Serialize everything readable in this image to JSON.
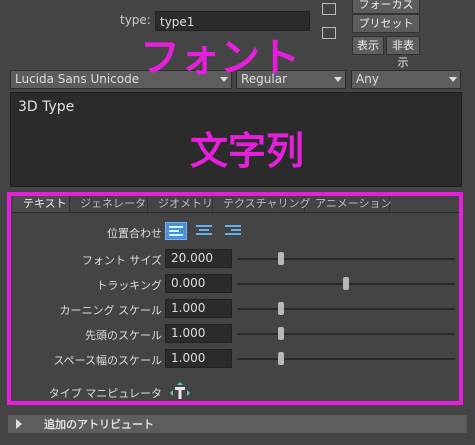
{
  "header": {
    "type_label": "type:",
    "type_value": "type1",
    "focus_button": "フォーカス",
    "preset_button": "プリセット",
    "show_button": "表示",
    "hide_button": "非表示"
  },
  "font": {
    "family": "Lucida Sans Unicode",
    "style": "Regular",
    "writing_system": "Any"
  },
  "text_input": {
    "value": "3D Type"
  },
  "annotations": {
    "font_overlay": "フォント",
    "string_overlay": "文字列",
    "highlight_color": "#e61fdc"
  },
  "tabs": [
    {
      "label": "テキスト",
      "active": true
    },
    {
      "label": "ジェネレータ",
      "active": false
    },
    {
      "label": "ジオメトリ",
      "active": false
    },
    {
      "label": "テクスチャリング",
      "active": false
    },
    {
      "label": "アニメーション",
      "active": false
    }
  ],
  "text_tab": {
    "alignment_label": "位置合わせ",
    "alignment_selected": "left",
    "rows": [
      {
        "label": "フォント サイズ",
        "value": "20.000",
        "slider_fraction": 0.2
      },
      {
        "label": "トラッキング",
        "value": "0.000",
        "slider_fraction": 0.5
      },
      {
        "label": "カーニング スケール",
        "value": "1.000",
        "slider_fraction": 0.2
      },
      {
        "label": "先頭のスケール",
        "value": "1.000",
        "slider_fraction": 0.2
      },
      {
        "label": "スペース幅のスケール",
        "value": "1.000",
        "slider_fraction": 0.2
      }
    ],
    "manipulator_label": "タイプ マニピュレータ",
    "manipulator_icon": "type-manipulator-icon"
  },
  "footer": {
    "label": "追加のアトリビュート"
  }
}
